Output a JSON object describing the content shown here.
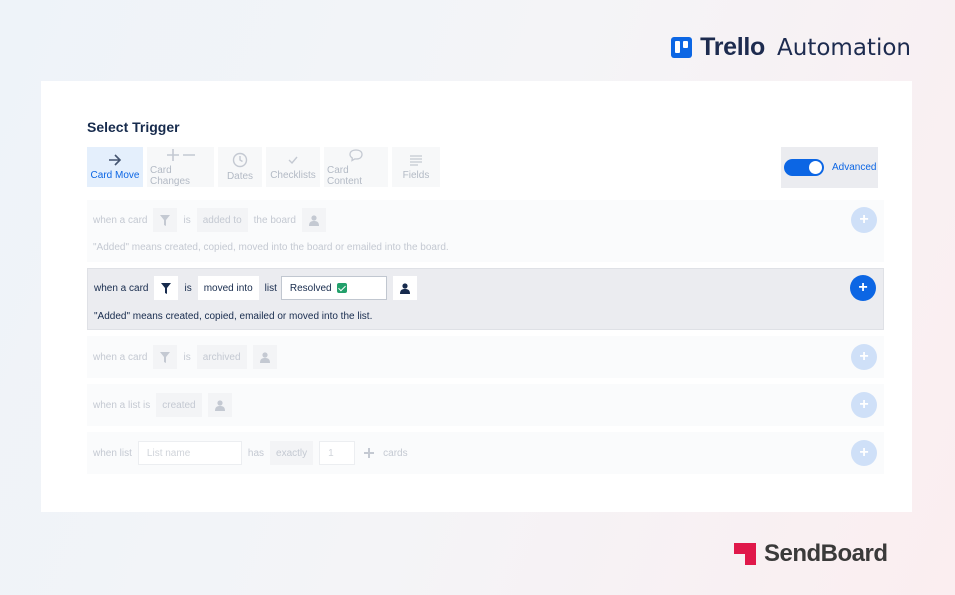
{
  "brand": {
    "trello": "Trello",
    "automation": "Automation",
    "sendboard": "SendBoard"
  },
  "panel": {
    "title": "Select Trigger"
  },
  "tabs": [
    {
      "label": "Card Move",
      "icon": "arrow-right-icon",
      "active": true
    },
    {
      "label": "Card Changes",
      "icon": "plus-minus-icon",
      "active": false
    },
    {
      "label": "Dates",
      "icon": "clock-icon",
      "active": false
    },
    {
      "label": "Checklists",
      "icon": "checkmark-icon",
      "active": false
    },
    {
      "label": "Card Content",
      "icon": "comment-icon",
      "active": false
    },
    {
      "label": "Fields",
      "icon": "lines-icon",
      "active": false
    }
  ],
  "advanced": {
    "label": "Advanced",
    "enabled": true
  },
  "triggers": {
    "r1": {
      "when": "when a card",
      "is": "is",
      "action": "added to",
      "target": "the board",
      "note": "\"Added\" means created, copied, moved into the board or emailed into the board."
    },
    "r2": {
      "when": "when a card",
      "is": "is",
      "action": "moved into",
      "list_word": "list",
      "list_value": "Resolved",
      "note": "\"Added\" means created, copied, emailed or moved into the list."
    },
    "r3": {
      "when": "when a card",
      "is": "is",
      "action": "archived"
    },
    "r4": {
      "when": "when a list is",
      "action": "created"
    },
    "r5": {
      "when": "when list",
      "placeholder": "List name",
      "has": "has",
      "qualifier": "exactly",
      "count": "1",
      "unit": "cards"
    }
  },
  "add_symbol": "+",
  "colors": {
    "accent": "#0c66e4",
    "sendboard": "#e0184a",
    "success": "#22a06b"
  }
}
